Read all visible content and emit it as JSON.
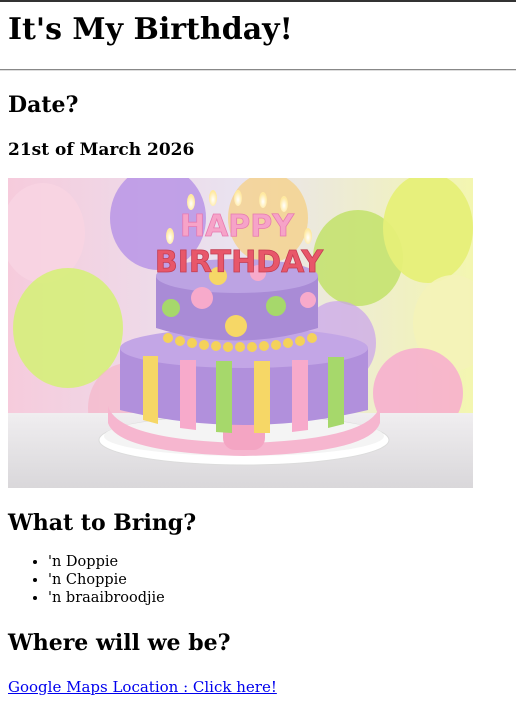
{
  "page": {
    "title": "It's My Birthday!",
    "date_heading": "Date?",
    "date_value": "21st of March 2026",
    "cake_image": {
      "alt": "",
      "banner_top": "HAPPY",
      "banner_bottom": "BIRTHDAY",
      "colors": {
        "background_left": "#f4c6d6",
        "background_right": "#f2f5a8",
        "cake_purple": "#a98bd6",
        "cake_pink": "#f2a9c7",
        "cake_yellow": "#f6d663",
        "cake_green": "#a7d96a",
        "plate": "#eeeeee"
      }
    },
    "bring_heading": "What to Bring?",
    "bring_items": [
      "'n Doppie",
      "'n Choppie",
      "'n braaibroodjie"
    ],
    "where_heading": "Where will we be?",
    "map_link_text": "Google Maps Location : Click here!"
  }
}
